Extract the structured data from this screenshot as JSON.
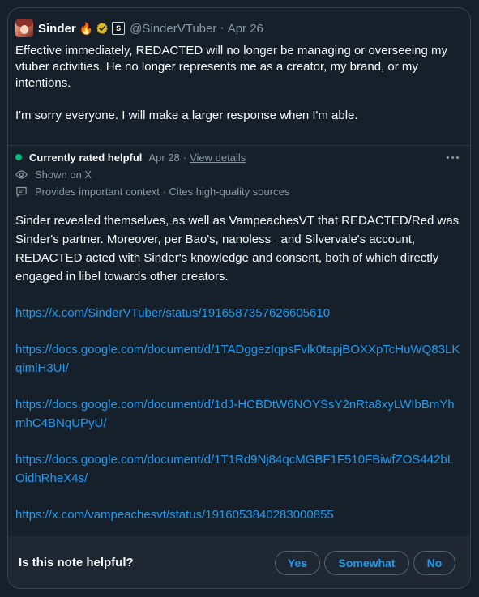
{
  "tweet": {
    "author_name": "Sinder",
    "handle": "@SinderVTuber",
    "separator": "·",
    "date": "Apr 26",
    "emoji": "🔥",
    "affiliate_badge": "S",
    "paragraphs": [
      "Effective immediately, REDACTED will no longer be managing or overseeing my vtuber activities. He no longer represents me as a creator, my brand, or my intentions.",
      "I'm sorry everyone. I will make a larger response when I'm able."
    ]
  },
  "note": {
    "status": "Currently rated helpful",
    "date": "Apr 28",
    "separator": "·",
    "details_link": "View details",
    "shown_on": "Shown on X",
    "context": "Provides important context · Cites high-quality sources",
    "body": "Sinder revealed themselves, as well as VampeachesVT that REDACTED/Red was Sinder's partner. Moreover, per Bao's, nanoless_ and Silvervale's account, REDACTED acted with Sinder's knowledge and consent, both of which directly engaged in libel towards other creators.",
    "links": [
      "https://x.com/SinderVTuber/status/1916587357626605610",
      "https://docs.google.com/document/d/1TADggezIqpsFvlk0tapjBOXXpTcHuWQ83LKqimiH3UI/",
      "https://docs.google.com/document/d/1dJ-HCBDtW6NOYSsY2nRta8xyLWIbBmYhmhC4BNqUPyU/",
      "https://docs.google.com/document/d/1T1Rd9Nj84qcMGBF1F510FBiwfZOS442bLOidhRheX4s/",
      "https://x.com/vampeachesvt/status/1916053840283000855"
    ]
  },
  "footer": {
    "question": "Is this note helpful?",
    "yes": "Yes",
    "somewhat": "Somewhat",
    "no": "No"
  },
  "colors": {
    "background": "#15202b",
    "link": "#1d9bf0",
    "helpful_green": "#00ba7c",
    "muted": "#8b98a5"
  }
}
